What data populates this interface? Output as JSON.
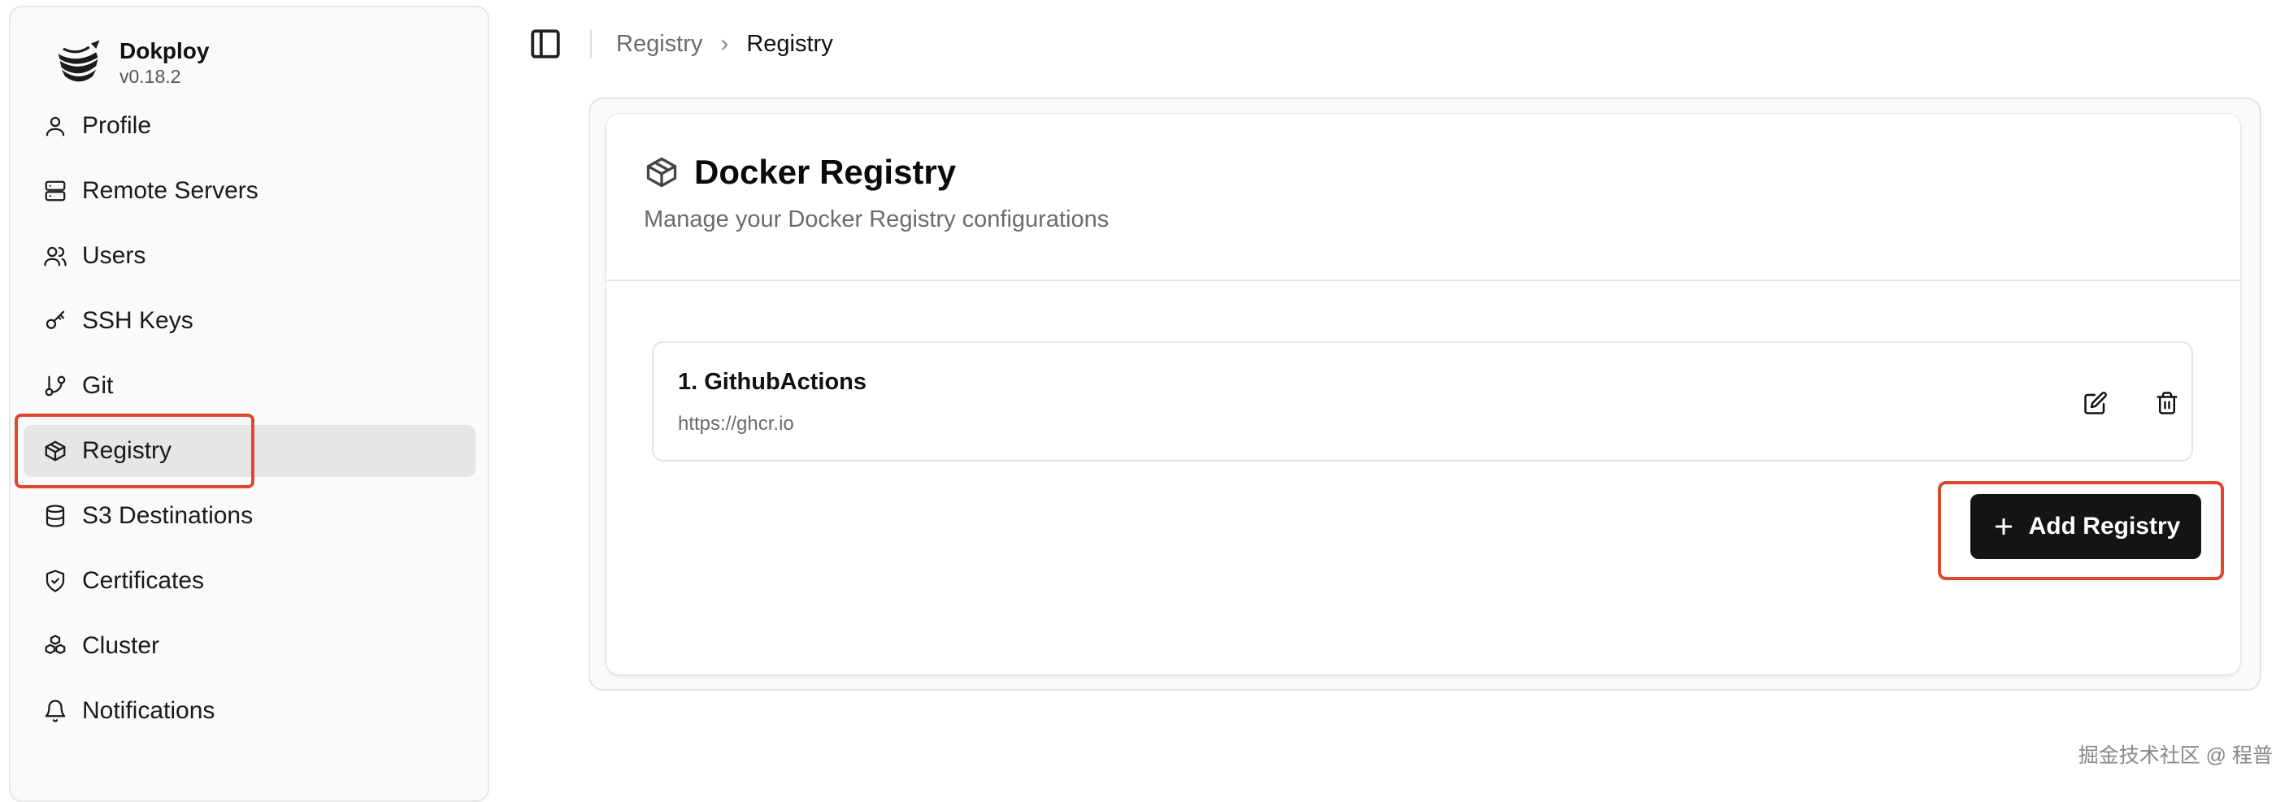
{
  "brand": {
    "name": "Dokploy",
    "version": "v0.18.2"
  },
  "sidebar": {
    "items": [
      {
        "label": "Profile",
        "icon": "user-icon",
        "active": false
      },
      {
        "label": "Remote Servers",
        "icon": "server-icon",
        "active": false
      },
      {
        "label": "Users",
        "icon": "users-icon",
        "active": false
      },
      {
        "label": "SSH Keys",
        "icon": "key-icon",
        "active": false
      },
      {
        "label": "Git",
        "icon": "git-branch-icon",
        "active": false
      },
      {
        "label": "Registry",
        "icon": "package-icon",
        "active": true
      },
      {
        "label": "S3 Destinations",
        "icon": "database-icon",
        "active": false
      },
      {
        "label": "Certificates",
        "icon": "shield-check-icon",
        "active": false
      },
      {
        "label": "Cluster",
        "icon": "boxes-icon",
        "active": false
      },
      {
        "label": "Notifications",
        "icon": "bell-icon",
        "active": false
      }
    ]
  },
  "breadcrumb": {
    "items": [
      "Registry",
      "Registry"
    ]
  },
  "card": {
    "title": "Docker Registry",
    "description": "Manage your Docker Registry configurations"
  },
  "registries": [
    {
      "name": "1. GithubActions",
      "url": "https://ghcr.io"
    }
  ],
  "actions": {
    "add_registry_label": "Add Registry"
  },
  "highlight_color": "#e0472f",
  "watermark": "掘金技术社区 @ 程普"
}
